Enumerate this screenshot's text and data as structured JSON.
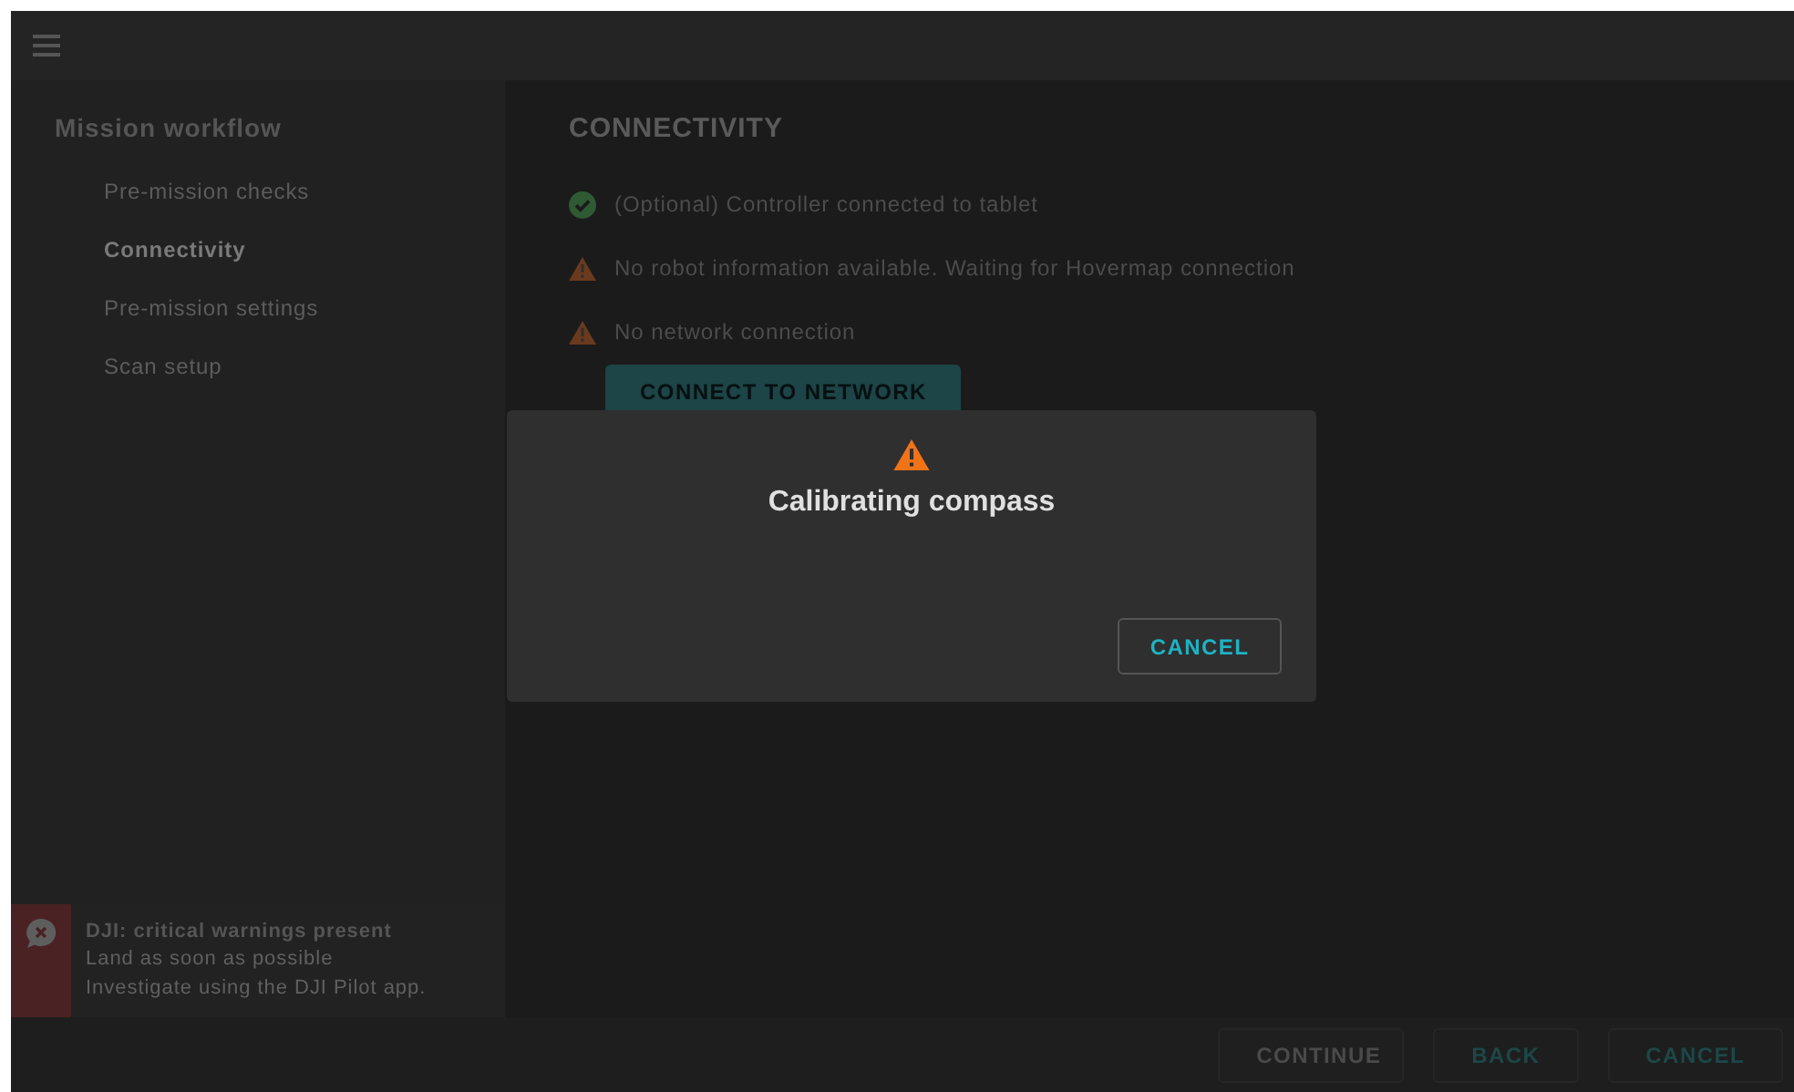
{
  "sidebar": {
    "title": "Mission workflow",
    "items": [
      {
        "label": "Pre-mission checks",
        "selected": false
      },
      {
        "label": "Connectivity",
        "selected": true
      },
      {
        "label": "Pre-mission settings",
        "selected": false
      },
      {
        "label": "Scan setup",
        "selected": false
      }
    ]
  },
  "section": {
    "title": "CONNECTIVITY",
    "statuses": [
      {
        "kind": "ok",
        "text": "(Optional) Controller connected to tablet"
      },
      {
        "kind": "warning",
        "text": "No robot information available. Waiting for Hovermap connection"
      },
      {
        "kind": "warning",
        "text": "No network connection"
      }
    ],
    "action": "CONNECT TO NETWORK"
  },
  "alert": {
    "title": "DJI: critical warnings present",
    "lines": [
      "Land as soon as possible",
      "Investigate using the DJI Pilot app."
    ]
  },
  "footer_buttons": [
    {
      "label": "CONTINUE",
      "disabled": true
    },
    {
      "label": "BACK",
      "disabled": false
    },
    {
      "label": "CANCEL",
      "disabled": false
    }
  ],
  "dialog": {
    "title": "Calibrating compass",
    "button": "CANCEL"
  }
}
